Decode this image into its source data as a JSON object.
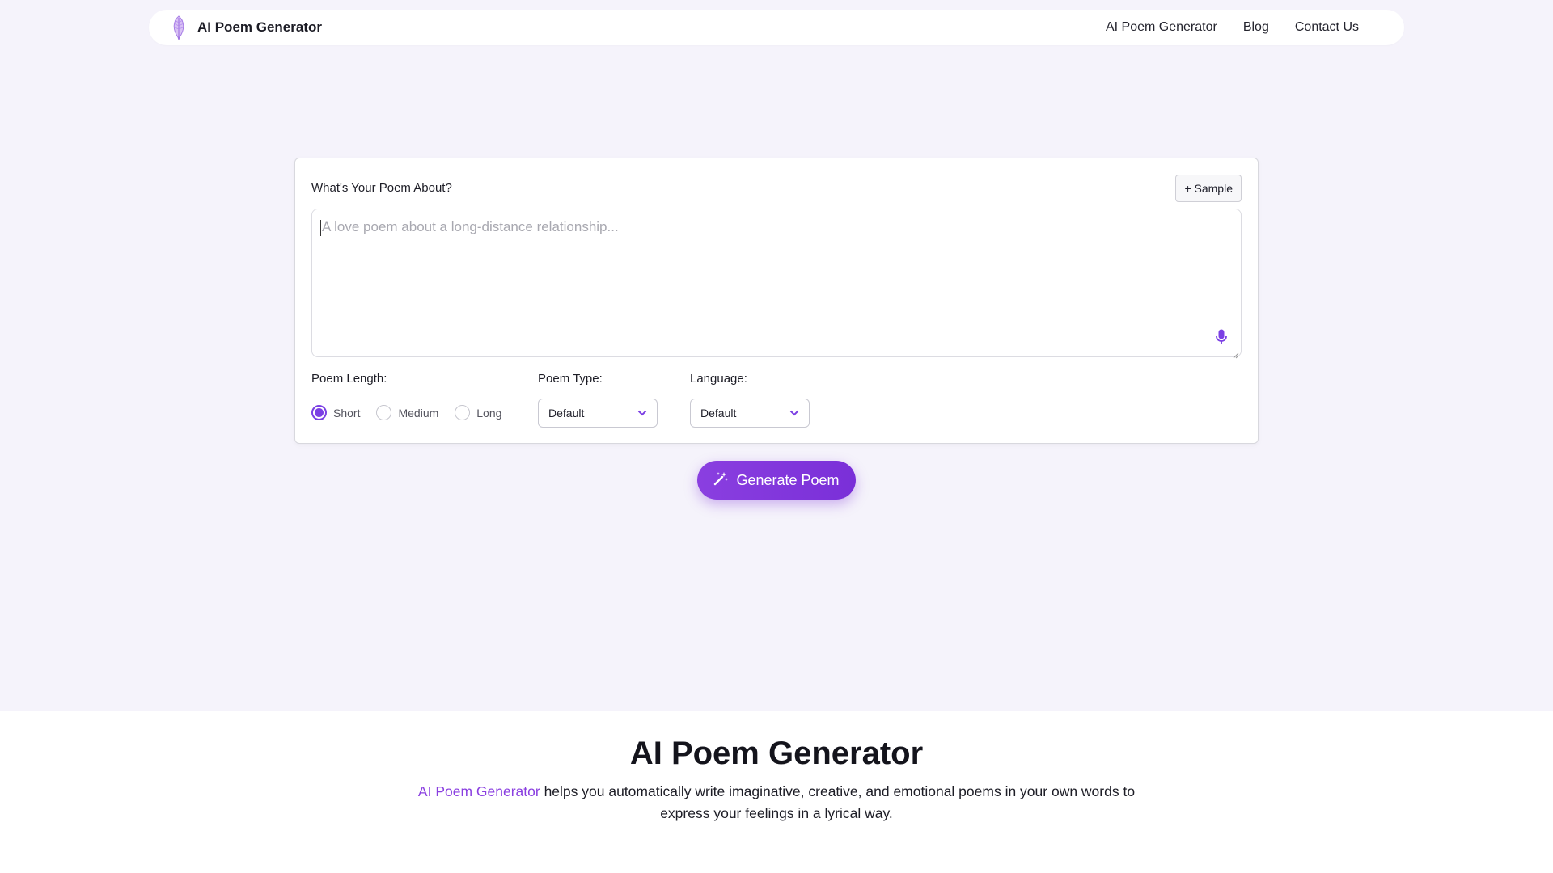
{
  "nav": {
    "brand": "AI Poem Generator",
    "links": [
      "AI Poem Generator",
      "Blog",
      "Contact Us"
    ]
  },
  "form": {
    "title": "What's Your Poem About?",
    "sample_button": "+ Sample",
    "placeholder": "A love poem about a long-distance relationship...",
    "value": "",
    "length_label": "Poem Length:",
    "length_options": [
      "Short",
      "Medium",
      "Long"
    ],
    "length_selected": "Short",
    "type_label": "Poem Type:",
    "type_value": "Default",
    "language_label": "Language:",
    "language_value": "Default",
    "generate_button": "Generate Poem"
  },
  "intro": {
    "title": "AI Poem Generator",
    "desc_highlight": "AI Poem Generator",
    "desc_rest": " helps you automatically write imaginative, creative, and emotional poems in your own words to express your feelings in a lyrical way."
  },
  "colors": {
    "accent": "#7b3fe4",
    "background": "#f5f3fb"
  },
  "icons": [
    "feather-logo-icon",
    "microphone-icon",
    "chevron-down-icon",
    "magic-wand-icon"
  ]
}
